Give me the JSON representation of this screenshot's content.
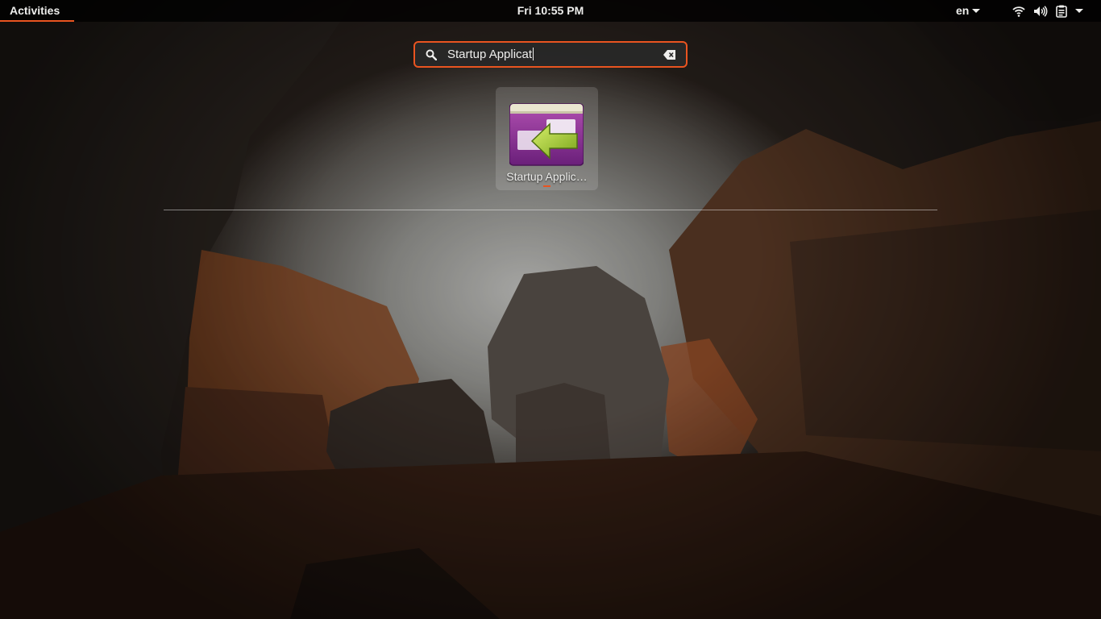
{
  "topbar": {
    "activities_label": "Activities",
    "clock": "Fri 10:55 PM",
    "language": "en",
    "accent_color": "#e95420",
    "tray_icons": [
      "wifi-icon",
      "volume-icon",
      "battery-icon",
      "system-menu-caret-icon"
    ]
  },
  "search": {
    "value": "Startup Applicat",
    "icon": "search-icon",
    "clear_icon": "clear-text-icon"
  },
  "results": [
    {
      "label": "Startup Applic…",
      "icon": "startup-applications-icon"
    }
  ]
}
